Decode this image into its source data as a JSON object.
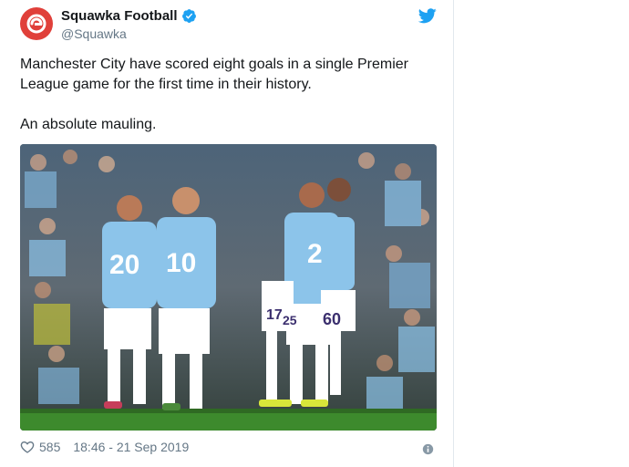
{
  "tweet": {
    "display_name": "Squawka Football",
    "handle": "@Squawka",
    "text_lines": [
      "Manchester City have scored eight goals in a single Premier League game for the first time in their history.",
      "An absolute mauling."
    ],
    "likes": "585",
    "timestamp": "18:46 - 21 Sep 2019"
  },
  "icons": {
    "avatar": "squawka-logo-icon",
    "verified": "verified-badge-icon",
    "brand": "twitter-bird-icon",
    "like": "heart-icon",
    "info": "info-icon"
  },
  "colors": {
    "accent": "#1da1f2",
    "avatar_bg": "#e0403a",
    "text": "#14171a",
    "muted": "#657786",
    "border": "#e1e8ed",
    "kit_sky_blue": "#8cc4ea"
  },
  "photo": {
    "shirt_numbers": [
      "20",
      "10",
      "2",
      "60",
      "17",
      "25"
    ]
  }
}
